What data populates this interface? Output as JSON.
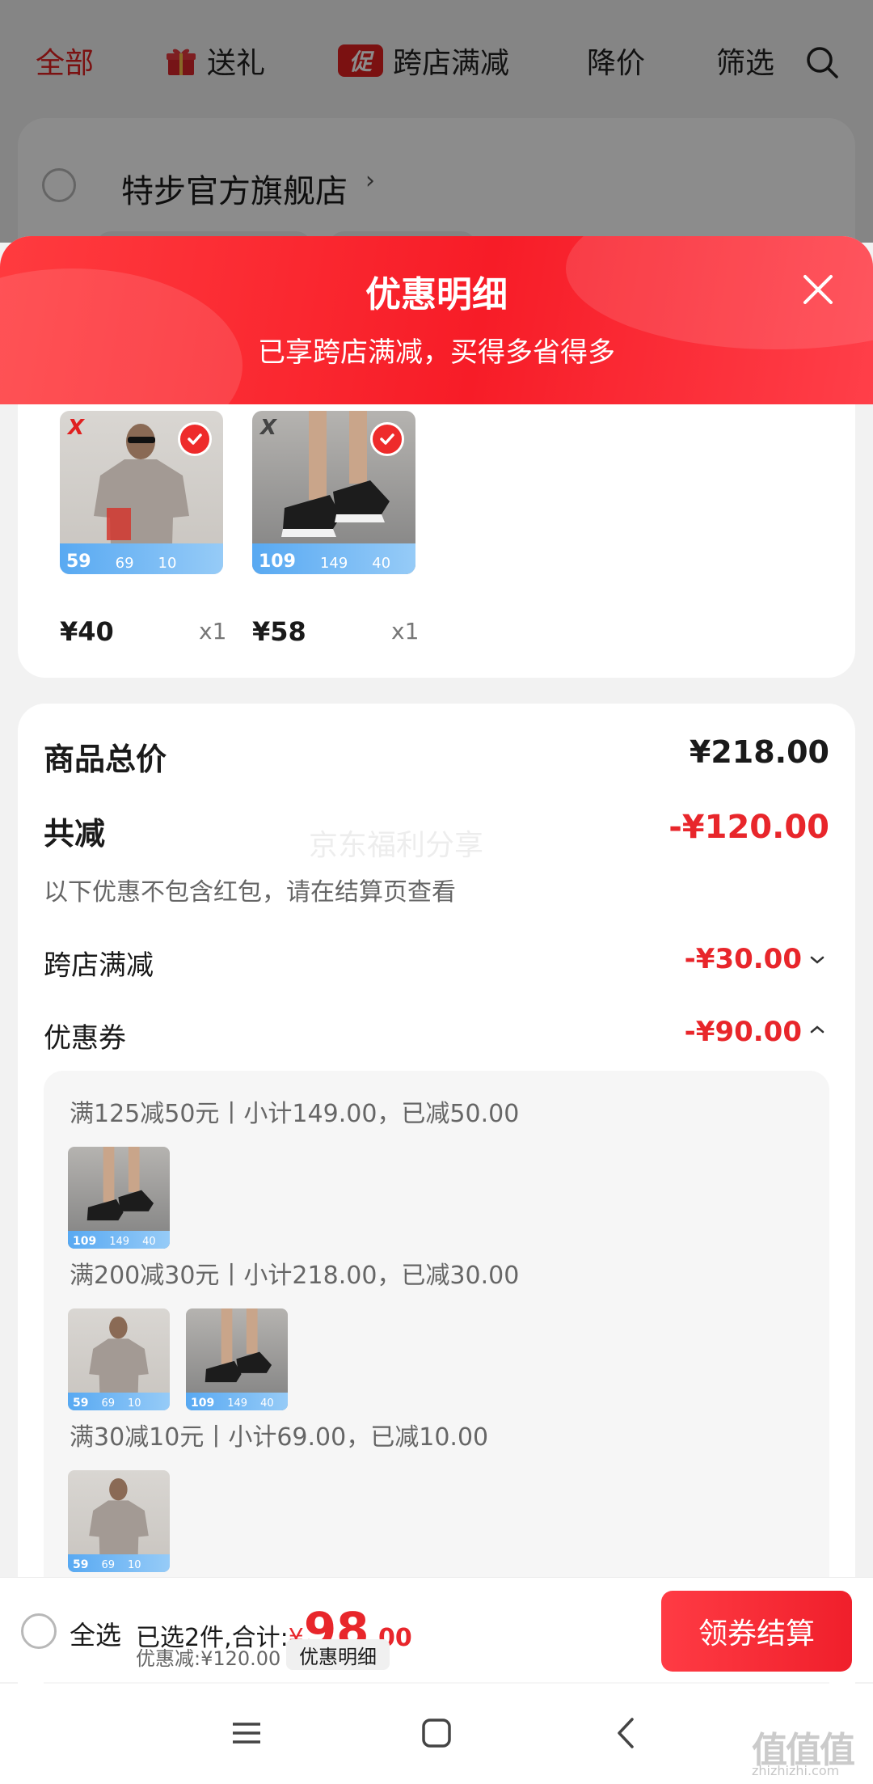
{
  "nav": {
    "tabs": [
      {
        "label": "全部",
        "active": true
      },
      {
        "label": "送礼",
        "icon": "gift-icon"
      },
      {
        "label": "跨店满减",
        "badge": "促"
      },
      {
        "label": "降价"
      },
      {
        "label": "筛选"
      }
    ],
    "search_icon": "search-icon"
  },
  "store": {
    "name": "特步官方旗舰店",
    "chevron": "›"
  },
  "sheet": {
    "title": "优惠明细",
    "subtitle": "已享跨店满减，买得多省得多",
    "close_icon": "close-icon"
  },
  "products": [
    {
      "price": "¥40",
      "qty": "x1",
      "strip": [
        "59",
        "69",
        "10"
      ]
    },
    {
      "price": "¥58",
      "qty": "x1",
      "strip": [
        "109",
        "149",
        "40"
      ]
    }
  ],
  "summary": {
    "total_label": "商品总价",
    "total_value": "¥218.00",
    "reduce_label": "共减",
    "reduce_value": "-¥120.00",
    "note": "以下优惠不包含红包，请在结算页查看",
    "watermark": "京东福利分享",
    "rows": [
      {
        "label": "跨店满减",
        "value": "-¥30.00",
        "chevron": "chevron-down-icon"
      },
      {
        "label": "优惠券",
        "value": "-¥90.00",
        "chevron": "chevron-up-icon"
      }
    ]
  },
  "coupons": [
    {
      "text": "满125减50元丨小计149.00，已减50.00"
    },
    {
      "text": "满200减30元丨小计218.00，已减30.00"
    },
    {
      "text": "满30减10元丨小计69.00，已减10.00"
    }
  ],
  "bottom": {
    "select_all": "全选",
    "selected": "已选2件,合计:",
    "currency": "¥",
    "total_int": "98",
    "total_dec": ".00",
    "discount": "优惠减:¥120.00",
    "detail_button": "优惠明细",
    "checkout_button": "领券结算"
  },
  "corner_mark": {
    "text": "值值值",
    "sub": "zhizhizhi.com"
  },
  "colors": {
    "accent": "#e8262b",
    "header": "#f71c27",
    "strip": "#58a9f2"
  }
}
